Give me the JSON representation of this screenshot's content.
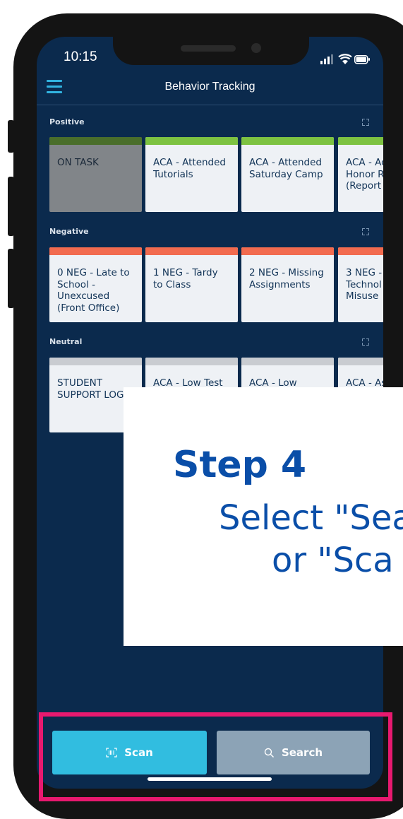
{
  "status_bar": {
    "time": "10:15"
  },
  "header": {
    "title": "Behavior Tracking"
  },
  "sections": [
    {
      "label": "Positive",
      "stripe_color": "#7dc241",
      "tiles": [
        {
          "label": "ON TASK",
          "selected": true
        },
        {
          "label": "ACA - Attended\nTutorials"
        },
        {
          "label": "ACA - Attended\nSaturday Camp"
        },
        {
          "label": "ACA - Ac\nHonor R\n(Report"
        }
      ]
    },
    {
      "label": "Negative",
      "stripe_color": "#f26b4f",
      "tiles": [
        {
          "label": "0 NEG - Late to\nSchool -\nUnexcused\n(Front Office)"
        },
        {
          "label": "1 NEG - Tardy\nto Class"
        },
        {
          "label": "2 NEG - Missing\nAssignments"
        },
        {
          "label": "3 NEG -\nTechnol\nMisuse"
        }
      ]
    },
    {
      "label": "Neutral",
      "stripe_color": "#c9ccd1",
      "tiles": [
        {
          "label": "STUDENT\nSUPPORT LOG"
        },
        {
          "label": "ACA - Low Test"
        },
        {
          "label": "ACA - Low"
        },
        {
          "label": "ACA - As"
        }
      ]
    }
  ],
  "overlay": {
    "title": "Step 4",
    "line1": "Select \"Sea",
    "line2": "or \"Sca"
  },
  "actions": {
    "scan_label": "Scan",
    "search_label": "Search"
  },
  "colors": {
    "app_background": "#0b2a4d",
    "accent": "#31bde0",
    "search_button": "#8ca3b6",
    "highlight": "#e8196f",
    "overlay_text": "#0a4ea8"
  },
  "icons": [
    "menu-icon",
    "expand-icon",
    "scan-icon",
    "search-icon",
    "signal-icon",
    "wifi-icon",
    "battery-icon"
  ]
}
